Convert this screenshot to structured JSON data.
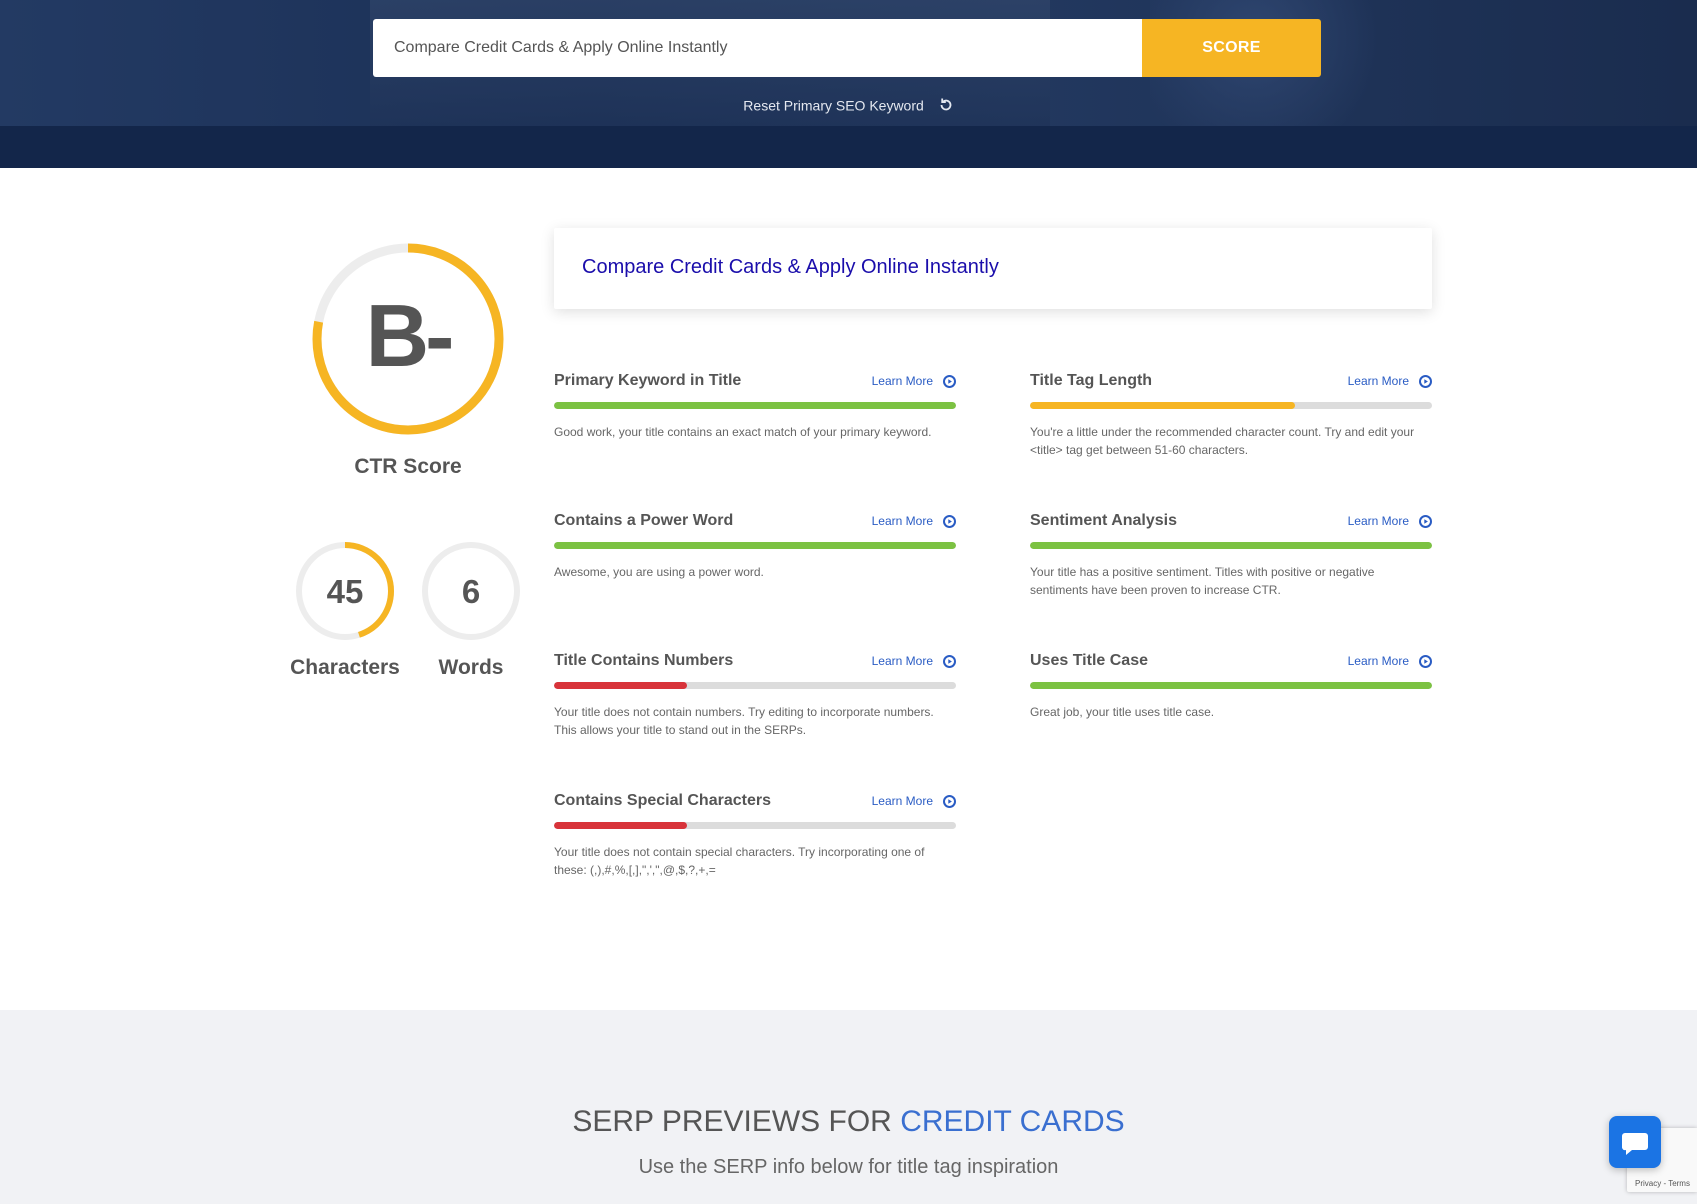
{
  "search": {
    "value": "Compare Credit Cards & Apply Online Instantly",
    "button_label": "SCORE",
    "reset_label": "Reset Primary SEO Keyword"
  },
  "score": {
    "grade": "B-",
    "label": "CTR Score",
    "ring_fraction": 0.78,
    "accent_color": "#f6b523"
  },
  "stats": {
    "characters": {
      "value": "45",
      "label": "Characters",
      "ring_fraction": 0.45
    },
    "words": {
      "value": "6",
      "label": "Words",
      "ring_fraction": 0
    }
  },
  "title_preview": "Compare Credit Cards & Apply Online Instantly",
  "metrics": [
    {
      "title": "Primary Keyword in Title",
      "learn": "Learn More",
      "fill": 1.0,
      "color": "#7cc242",
      "desc": "Good work, your title contains an exact match of your primary keyword."
    },
    {
      "title": "Title Tag Length",
      "learn": "Learn More",
      "fill": 0.66,
      "color": "#f6b523",
      "desc": "You're a little under the recommended character count. Try and edit your <title> tag get between 51-60 characters."
    },
    {
      "title": "Contains a Power Word",
      "learn": "Learn More",
      "fill": 1.0,
      "color": "#7cc242",
      "desc": "Awesome, you are using a power word."
    },
    {
      "title": "Sentiment Analysis",
      "learn": "Learn More",
      "fill": 1.0,
      "color": "#7cc242",
      "desc": "Your title has a positive sentiment. Titles with positive or negative sentiments have been proven to increase CTR."
    },
    {
      "title": "Title Contains Numbers",
      "learn": "Learn More",
      "fill": 0.33,
      "color": "#d8333a",
      "desc": "Your title does not contain numbers. Try editing to incorporate numbers. This allows your title to stand out in the SERPs."
    },
    {
      "title": "Uses Title Case",
      "learn": "Learn More",
      "fill": 1.0,
      "color": "#7cc242",
      "desc": "Great job, your title uses title case."
    },
    {
      "title": "Contains Special Characters",
      "learn": "Learn More",
      "fill": 0.33,
      "color": "#d8333a",
      "desc": "Your title does not contain special characters. Try incorporating one of these: (,),#,%,[,],\",',\",@,$,?,+,="
    }
  ],
  "serp": {
    "heading_prefix": "SERP PREVIEWS FOR ",
    "heading_keyword": "CREDIT CARDS",
    "subheading": "Use the SERP info below for title tag inspiration"
  },
  "recaptcha_text": "Privacy - Terms"
}
